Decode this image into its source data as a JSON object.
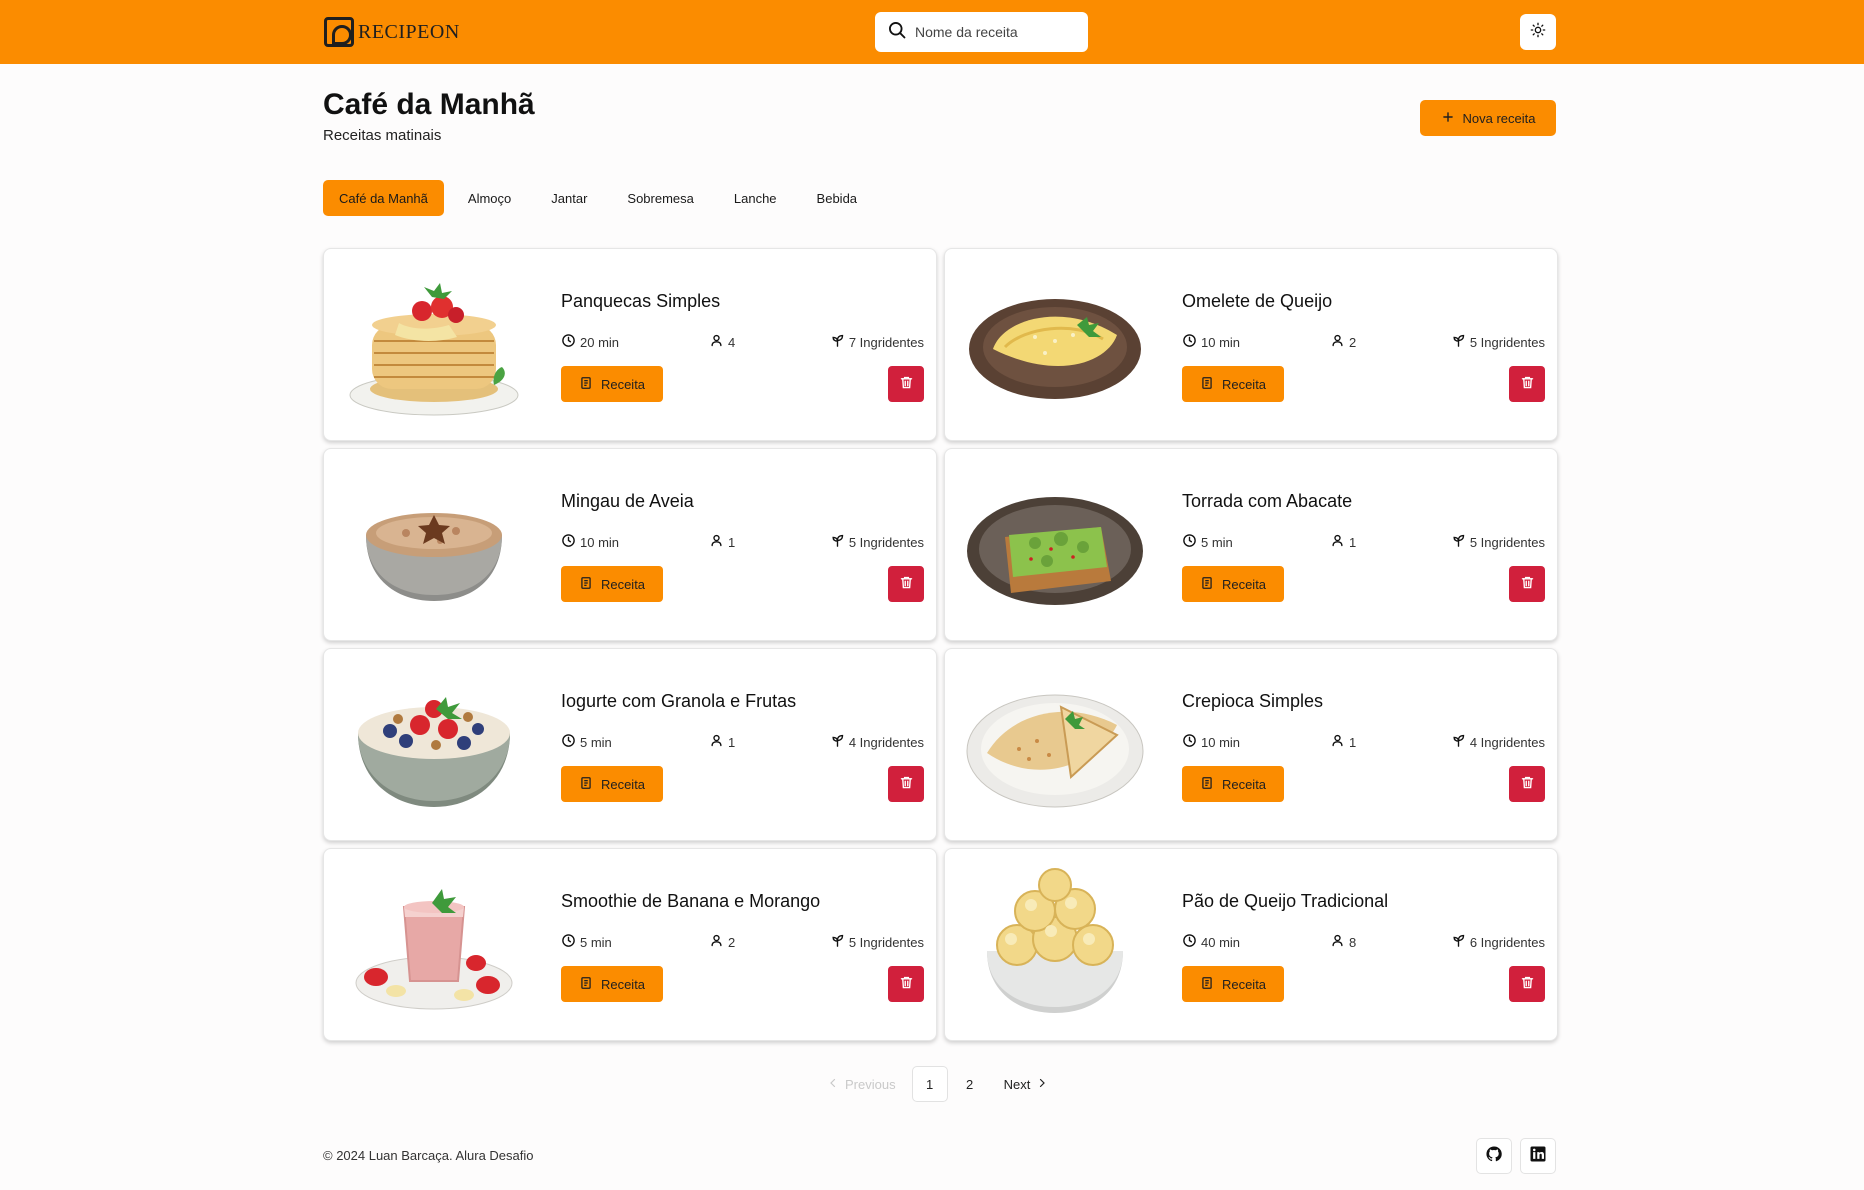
{
  "header": {
    "logo_text": "RECIPEON",
    "search_placeholder": "Nome da receita"
  },
  "page": {
    "title": "Café da Manhã",
    "subtitle": "Receitas matinais",
    "new_button": "Nova receita"
  },
  "tabs": [
    {
      "label": "Café da Manhã",
      "active": true
    },
    {
      "label": "Almoço"
    },
    {
      "label": "Jantar"
    },
    {
      "label": "Sobremesa"
    },
    {
      "label": "Lanche"
    },
    {
      "label": "Bebida"
    }
  ],
  "recipes": [
    {
      "title": "Panquecas Simples",
      "time": "20 min",
      "servings": "4",
      "ingredients": "7 Ingridentes",
      "image": "pancake-stack"
    },
    {
      "title": "Omelete de Queijo",
      "time": "10 min",
      "servings": "2",
      "ingredients": "5 Ingridentes",
      "image": "omelette-plate"
    },
    {
      "title": "Mingau de Aveia",
      "time": "10 min",
      "servings": "1",
      "ingredients": "5 Ingridentes",
      "image": "oatmeal-bowl"
    },
    {
      "title": "Torrada com Abacate",
      "time": "5 min",
      "servings": "1",
      "ingredients": "5 Ingridentes",
      "image": "avocado-toast-plate"
    },
    {
      "title": "Iogurte com Granola e Frutas",
      "time": "5 min",
      "servings": "1",
      "ingredients": "4 Ingridentes",
      "image": "yogurt-bowl"
    },
    {
      "title": "Crepioca Simples",
      "time": "10 min",
      "servings": "1",
      "ingredients": "4 Ingridentes",
      "image": "crepe-plate"
    },
    {
      "title": "Smoothie de Banana e Morango",
      "time": "5 min",
      "servings": "2",
      "ingredients": "5 Ingridentes",
      "image": "smoothie-glass"
    },
    {
      "title": "Pão de Queijo Tradicional",
      "time": "40 min",
      "servings": "8",
      "ingredients": "6 Ingridentes",
      "image": "cheese-bread-bowl"
    }
  ],
  "recipe_button_label": "Receita",
  "pagination": {
    "previous": "Previous",
    "pages": [
      "1",
      "2"
    ],
    "current": "1",
    "next": "Next"
  },
  "footer": {
    "text": "© 2024 Luan Barcaça. Alura Desafio"
  },
  "colors": {
    "accent": "#fb8c00",
    "danger": "#d1203c"
  }
}
